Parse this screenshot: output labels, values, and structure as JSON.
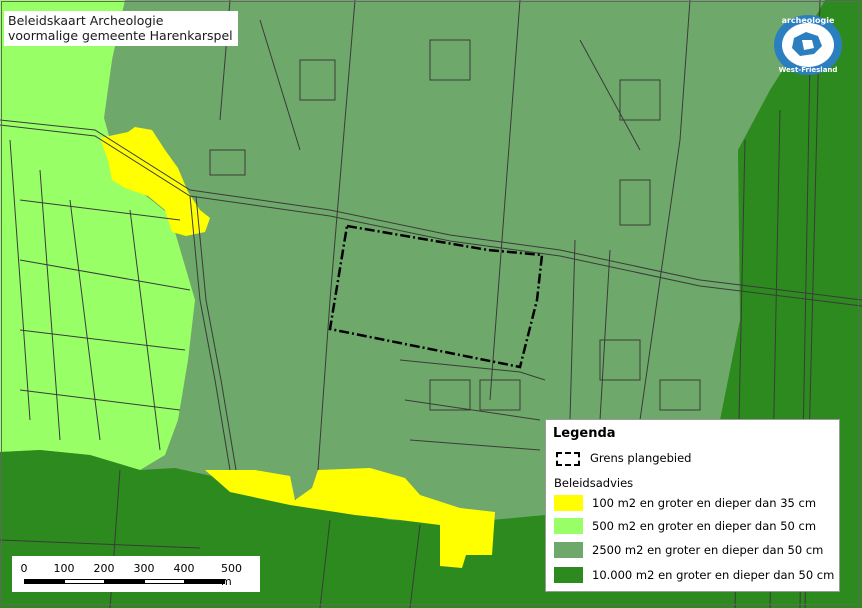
{
  "title": {
    "line1": "Beleidskaart Archeologie",
    "line2": "voormalige gemeente Harenkarspel"
  },
  "logo": {
    "top_text": "archeologie",
    "bottom_text": "West-Friesland"
  },
  "legend": {
    "title": "Legenda",
    "boundary_label": "Grens plangebied",
    "subtitle": "Beleidsadvies",
    "items": [
      {
        "label": "100 m2 en groter en dieper dan 35 cm",
        "color": "#ffff00"
      },
      {
        "label": "500 m2 en groter en dieper dan 50 cm",
        "color": "#99ff66"
      },
      {
        "label": "2500 m2 en groter en dieper dan 50 cm",
        "color": "#6fa86b"
      },
      {
        "label": "10.000 m2 en groter en dieper dan 50 cm",
        "color": "#2d8a1e"
      }
    ]
  },
  "scalebar": {
    "ticks": [
      "0",
      "100",
      "200",
      "300",
      "400",
      "500 m"
    ]
  },
  "colors": {
    "yellow_zone": "#ffff00",
    "light_green_zone": "#99ff66",
    "mid_green_zone": "#6fa86b",
    "dark_green_zone": "#2d8a1e",
    "line_work": "#3b3b3b"
  }
}
